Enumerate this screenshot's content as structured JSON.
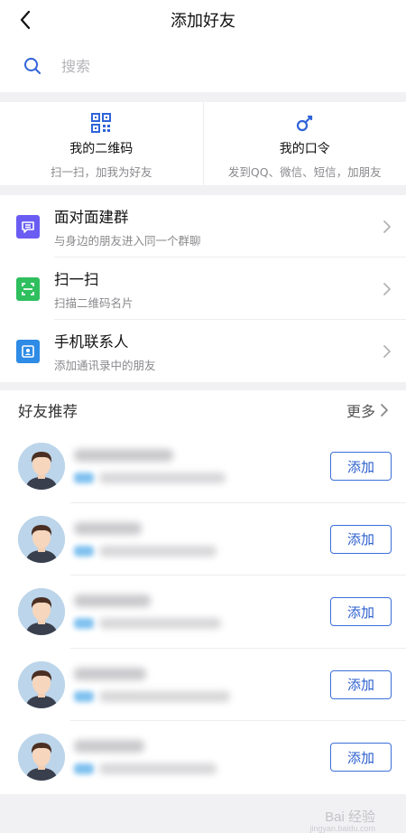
{
  "header": {
    "title": "添加好友"
  },
  "search": {
    "placeholder": "搜索"
  },
  "quick": [
    {
      "title": "我的二维码",
      "subtitle": "扫一扫，加我为好友",
      "icon": "qr-code-icon"
    },
    {
      "title": "我的口令",
      "subtitle": "发到QQ、微信、短信，加朋友",
      "icon": "key-icon"
    }
  ],
  "menu": [
    {
      "title": "面对面建群",
      "subtitle": "与身边的朋友进入同一个群聊",
      "icon": "face-to-face-group-icon",
      "color": "#6a5cf2"
    },
    {
      "title": "扫一扫",
      "subtitle": "扫描二维码名片",
      "icon": "scan-icon",
      "color": "#2fbf5e"
    },
    {
      "title": "手机联系人",
      "subtitle": "添加通讯录中的朋友",
      "icon": "contacts-icon",
      "color": "#2e8be6"
    }
  ],
  "recommend": {
    "title": "好友推荐",
    "more": "更多",
    "add_label": "添加",
    "items_count_visible": 5
  },
  "watermark": {
    "text": "Bai 经验",
    "url": "jingyan.baidu.com"
  },
  "colors": {
    "accent": "#3b6fd8",
    "background": "#f1f1f3"
  }
}
